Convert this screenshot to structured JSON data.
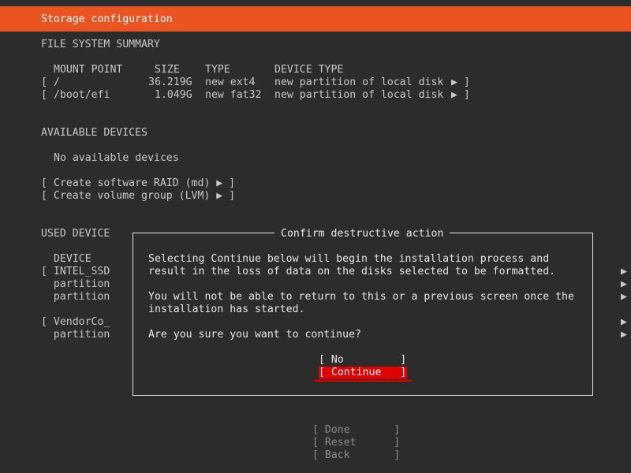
{
  "header": {
    "title": "Storage configuration"
  },
  "summary": {
    "heading": "FILE SYSTEM SUMMARY",
    "columns": {
      "mount_point": "MOUNT POINT",
      "size": "SIZE",
      "type": "TYPE",
      "device_type": "DEVICE TYPE"
    },
    "rows": [
      {
        "open": "[",
        "mount": "/",
        "size": "36.219G",
        "type": "new ext4",
        "device_type": "new partition of local disk",
        "arrow": "▶ ]"
      },
      {
        "open": "[",
        "mount": "/boot/efi",
        "size": "1.049G",
        "type": "new fat32",
        "device_type": "new partition of local disk",
        "arrow": "▶ ]"
      }
    ]
  },
  "available": {
    "heading": "AVAILABLE DEVICES",
    "none_text": "No available devices",
    "actions": [
      "[ Create software RAID (md) ▶ ]",
      "[ Create volume group (LVM) ▶ ]"
    ]
  },
  "used": {
    "heading": "USED DEVICE",
    "device_col": "DEVICE",
    "lines": [
      "[ INTEL_SSD",
      "  partition",
      "  partition",
      "",
      "[ VendorCo_",
      "  partition"
    ],
    "arrow": "▶"
  },
  "dialog": {
    "title": "Confirm destructive action",
    "line1": "Selecting Continue below will begin the installation process and",
    "line2": "result in the loss of data on the disks selected to be formatted.",
    "line3": "You will not be able to return to this or a previous screen once the",
    "line4": "installation has started.",
    "question": "Are you sure you want to continue?",
    "no_button": "[ No         ]",
    "continue_button": "[ Continue   ]"
  },
  "footer": {
    "done": "[ Done       ]",
    "reset": "[ Reset      ]",
    "back": "[ Back       ]"
  },
  "colors": {
    "header_bg": "#e95420",
    "focus_bg": "#e00000",
    "background": "#2c2c2c"
  }
}
